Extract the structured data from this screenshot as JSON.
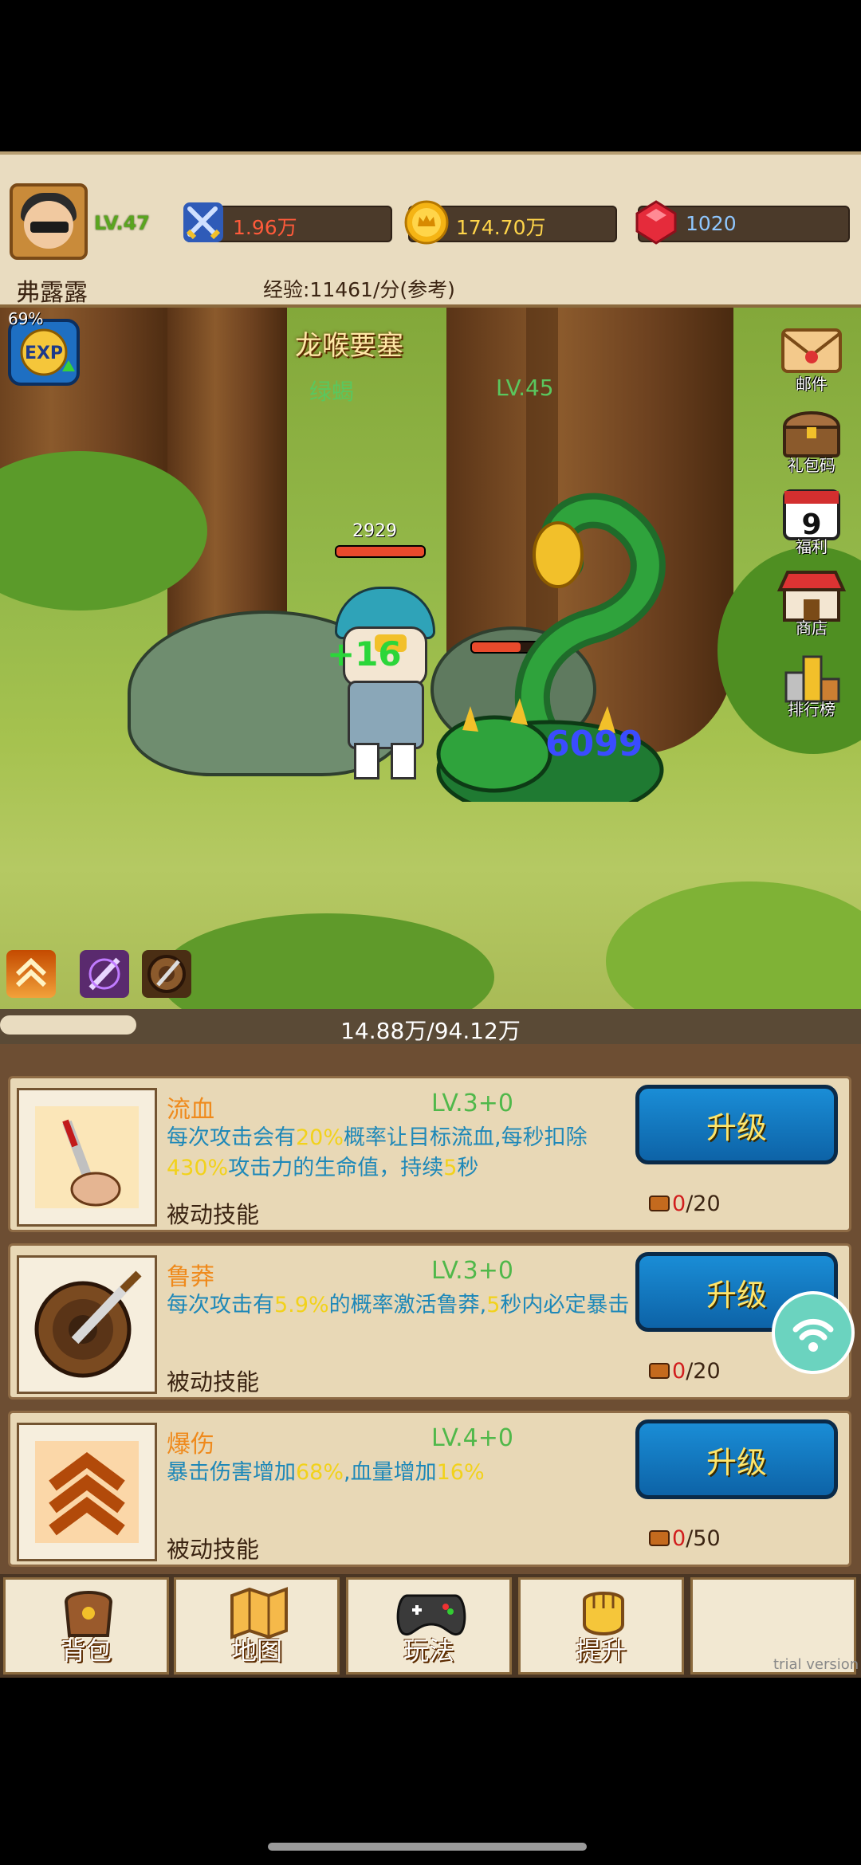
{
  "player": {
    "name": "弗露露",
    "level": "LV.47"
  },
  "resources": {
    "power": "1.96万",
    "gold": "174.70万",
    "gems": "1020"
  },
  "exp_rate": "经验:11461/分(参考)",
  "scene": {
    "stage": "龙喉要塞",
    "enemy_name": "绿蝎",
    "enemy_level": "LV.45",
    "hero_hp": "2929",
    "exp_boost_pct": "69%",
    "heal_number": "+16",
    "damage_number": "6099",
    "side_menu": [
      {
        "label": "邮件",
        "icon": "mail-icon"
      },
      {
        "label": "礼包码",
        "icon": "chest-icon"
      },
      {
        "label": "福利",
        "icon": "calendar-icon",
        "day": "9"
      },
      {
        "label": "商店",
        "icon": "shop-icon"
      },
      {
        "label": "排行榜",
        "icon": "ranking-icon"
      }
    ]
  },
  "progress": {
    "text": "14.88万/94.12万",
    "fraction": 0.158
  },
  "skills": [
    {
      "name": "流血",
      "level": "LV.3+0",
      "desc_parts": [
        "每次攻击会有",
        "20%",
        "概率让目标流血,每秒扣除",
        "430%",
        "攻击力的生命值，持续",
        "5",
        "秒"
      ],
      "type": "被动技能",
      "button": "升级",
      "cost_have": "0",
      "cost_need": "/20"
    },
    {
      "name": "鲁莽",
      "level": "LV.3+0",
      "desc_parts": [
        "每次攻击有",
        "5.9%",
        "的概率激活鲁莽,",
        "5",
        "秒内必定暴击"
      ],
      "type": "被动技能",
      "button": "升级",
      "cost_have": "0",
      "cost_need": "/20"
    },
    {
      "name": "爆伤",
      "level": "LV.4+0",
      "desc_parts": [
        "暴击伤害增加",
        "68%",
        ",血量增加",
        "16%"
      ],
      "type": "被动技能",
      "button": "升级",
      "cost_have": "0",
      "cost_need": "/50"
    }
  ],
  "nav": [
    {
      "label": "背包",
      "icon": "bag-icon"
    },
    {
      "label": "地图",
      "icon": "map-icon"
    },
    {
      "label": "玩法",
      "icon": "gamepad-icon"
    },
    {
      "label": "提升",
      "icon": "fist-icon"
    },
    {
      "label": "",
      "icon": ""
    }
  ],
  "watermark": "trial version",
  "colors": {
    "accent_blue": "#1a8dd6",
    "gold_text": "#ffe56a",
    "level_green": "#50b84a",
    "skill_name": "#ef8a1c",
    "desc_blue": "#1e88b8",
    "highlight_yellow": "#f2d21b"
  }
}
